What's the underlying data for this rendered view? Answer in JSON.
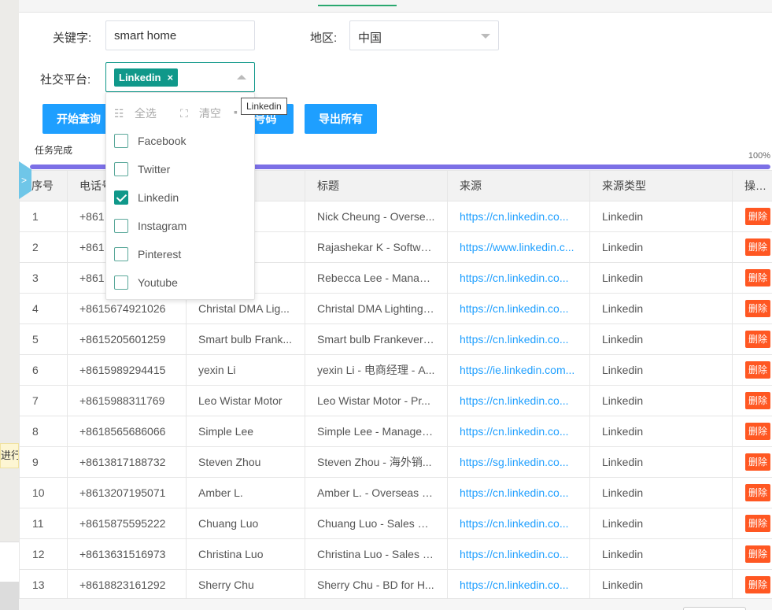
{
  "search": {
    "keyword_label": "关键字:",
    "keyword_value": "smart home",
    "region_label": "地区:",
    "region_value": "中国",
    "platform_label": "社交平台:",
    "platform_tag": "Linkedin",
    "tag_remove": "×"
  },
  "buttons": {
    "start": "开始查询",
    "middle": "号码",
    "export": "导出所有"
  },
  "dropdown": {
    "select_all": "全选",
    "clear": "清空",
    "options": [
      {
        "label": "Facebook",
        "checked": false
      },
      {
        "label": "Twitter",
        "checked": false
      },
      {
        "label": "Linkedin",
        "checked": true
      },
      {
        "label": "Instagram",
        "checked": false
      },
      {
        "label": "Pinterest",
        "checked": false
      },
      {
        "label": "Youtube",
        "checked": false
      }
    ]
  },
  "tooltip": "Linkedin",
  "status": {
    "text": "任务完成",
    "percent_label": "100%",
    "progress_fraction": 1.0
  },
  "side_tip": "进行",
  "side_handle": ">",
  "table": {
    "columns": [
      "序号",
      "电话号",
      "",
      "标题",
      "来源",
      "来源类型",
      "操作"
    ],
    "delete_label": "删除",
    "rows": [
      {
        "idx": "1",
        "phone": "+861",
        "name": "g",
        "title": "Nick Cheung - Overse...",
        "source": "https://cn.linkedin.co...",
        "type": "Linkedin"
      },
      {
        "idx": "2",
        "phone": "+861",
        "name": "K",
        "title": "Rajashekar K - Softwar...",
        "source": "https://www.linkedin.c...",
        "type": "Linkedin"
      },
      {
        "idx": "3",
        "phone": "+861",
        "name": "e",
        "title": "Rebecca Lee - Manage...",
        "source": "https://cn.linkedin.co...",
        "type": "Linkedin"
      },
      {
        "idx": "4",
        "phone": "+8615674921026",
        "name": "Christal DMA Lig...",
        "title": "Christal DMA Lighting ...",
        "source": "https://cn.linkedin.co...",
        "type": "Linkedin"
      },
      {
        "idx": "5",
        "phone": "+8615205601259",
        "name": "Smart bulb Frank...",
        "title": "Smart bulb Frankever ...",
        "source": "https://cn.linkedin.co...",
        "type": "Linkedin"
      },
      {
        "idx": "6",
        "phone": "+8615989294415",
        "name": "yexin Li",
        "title": "yexin Li - 电商经理 - A...",
        "source": "https://ie.linkedin.com...",
        "type": "Linkedin"
      },
      {
        "idx": "7",
        "phone": "+8615988311769",
        "name": "Leo Wistar Motor",
        "title": "Leo Wistar Motor - Pr...",
        "source": "https://cn.linkedin.co...",
        "type": "Linkedin"
      },
      {
        "idx": "8",
        "phone": "+8618565686066",
        "name": "Simple Lee",
        "title": "Simple Lee - Manager ...",
        "source": "https://cn.linkedin.co...",
        "type": "Linkedin"
      },
      {
        "idx": "9",
        "phone": "+8613817188732",
        "name": "Steven Zhou",
        "title": "Steven Zhou - 海外销...",
        "source": "https://sg.linkedin.co...",
        "type": "Linkedin"
      },
      {
        "idx": "10",
        "phone": "+8613207195071",
        "name": "Amber L.",
        "title": "Amber L. - Overseas S...",
        "source": "https://cn.linkedin.co...",
        "type": "Linkedin"
      },
      {
        "idx": "11",
        "phone": "+8615875595222",
        "name": "Chuang Luo",
        "title": "Chuang Luo - Sales En...",
        "source": "https://cn.linkedin.co...",
        "type": "Linkedin"
      },
      {
        "idx": "12",
        "phone": "+8613631516973",
        "name": "Christina Luo",
        "title": "Christina Luo - Sales D...",
        "source": "https://cn.linkedin.co...",
        "type": "Linkedin"
      },
      {
        "idx": "13",
        "phone": "+8618823161292",
        "name": "Sherry Chu",
        "title": "Sherry Chu - BD for H...",
        "source": "https://cn.linkedin.co...",
        "type": "Linkedin"
      }
    ]
  },
  "colors": {
    "primary_button": "#1e9fff",
    "tag": "#10988a",
    "progress": "#7b6fe6",
    "delete": "#ff5722",
    "link": "#1e9fff"
  }
}
